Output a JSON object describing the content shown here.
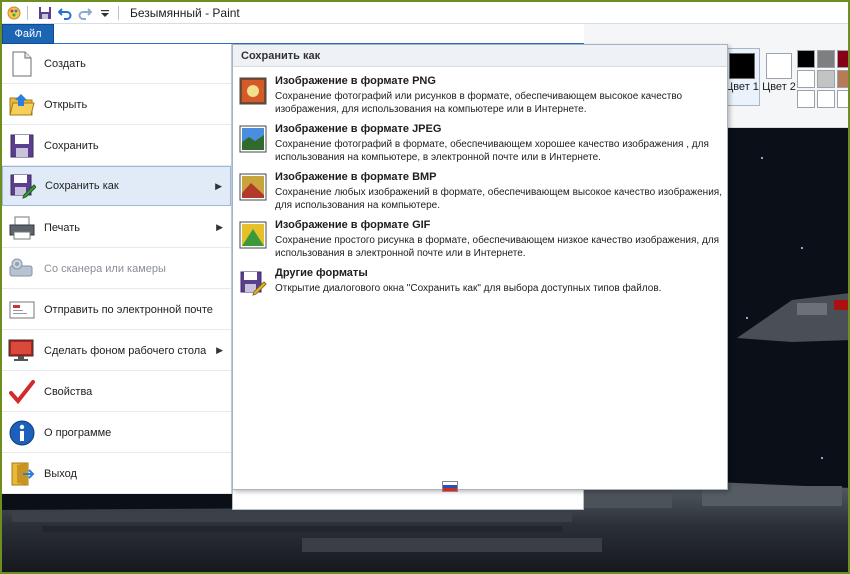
{
  "window": {
    "title": "Безымянный - Paint",
    "border_color": "#6e8e1f"
  },
  "quick_access": {
    "icons": [
      "paint-app-icon",
      "save-icon",
      "undo-icon",
      "redo-icon",
      "customize-dropdown-icon"
    ]
  },
  "ribbon": {
    "file_tab_label": "Файл",
    "color1_label": "Цвет 1",
    "color2_label": "Цвет 2",
    "color1_value": "#000000",
    "color2_value": "#ffffff",
    "palette": [
      "#000000",
      "#7f7f7f",
      "#880015",
      "#ffffff",
      "#c3c3c3",
      "#b97a57",
      "#ffffff",
      "#ffffff",
      "#ffffff"
    ]
  },
  "file_menu": {
    "items": [
      {
        "label": "Создать",
        "icon": "new-document-icon",
        "has_submenu": false,
        "disabled": false
      },
      {
        "label": "Открыть",
        "icon": "open-folder-icon",
        "has_submenu": false,
        "disabled": false
      },
      {
        "label": "Сохранить",
        "icon": "save-icon",
        "has_submenu": false,
        "disabled": false
      },
      {
        "label": "Сохранить как",
        "icon": "save-as-icon",
        "has_submenu": true,
        "disabled": false,
        "active": true
      },
      {
        "label": "Печать",
        "icon": "printer-icon",
        "has_submenu": true,
        "disabled": false
      },
      {
        "label": "Со сканера или камеры",
        "icon": "scanner-icon",
        "has_submenu": false,
        "disabled": true
      },
      {
        "label": "Отправить по электронной почте",
        "icon": "email-icon",
        "has_submenu": false,
        "disabled": false
      },
      {
        "label": "Сделать фоном рабочего стола",
        "icon": "desktop-background-icon",
        "has_submenu": true,
        "disabled": false
      },
      {
        "label": "Свойства",
        "icon": "checkmark-icon",
        "has_submenu": false,
        "disabled": false
      },
      {
        "label": "О программе",
        "icon": "info-icon",
        "has_submenu": false,
        "disabled": false
      },
      {
        "label": "Выход",
        "icon": "exit-icon",
        "has_submenu": false,
        "disabled": false
      }
    ]
  },
  "save_as": {
    "header": "Сохранить как",
    "options": [
      {
        "title": "Изображение в формате PNG",
        "desc": "Сохранение фотографий или рисунков в формате, обеспечивающем высокое качество изображения, для использования на компьютере или в Интернете.",
        "icon": "png-image-icon"
      },
      {
        "title": "Изображение в формате JPEG",
        "desc": "Сохранение фотографий в формате, обеспечивающем хорошее качество изображения , для использования на компьютере, в электронной почте или в Интернете.",
        "icon": "jpeg-image-icon"
      },
      {
        "title": "Изображение в формате BMP",
        "desc": "Сохранение любых изображений в формате, обеспечивающем высокое качество изображения, для использования на компьютере.",
        "icon": "bmp-image-icon"
      },
      {
        "title": "Изображение в формате GIF",
        "desc": "Сохранение простого рисунка в формате, обеспечивающем низкое качество изображения, для использования в электронной почте или в Интернете.",
        "icon": "gif-image-icon"
      },
      {
        "title": "Другие форматы",
        "desc": "Открытие диалогового окна \"Сохранить как\" для выбора доступных типов файлов.",
        "icon": "other-formats-icon"
      }
    ]
  },
  "status": {
    "language_flag": "russian-flag-icon"
  }
}
